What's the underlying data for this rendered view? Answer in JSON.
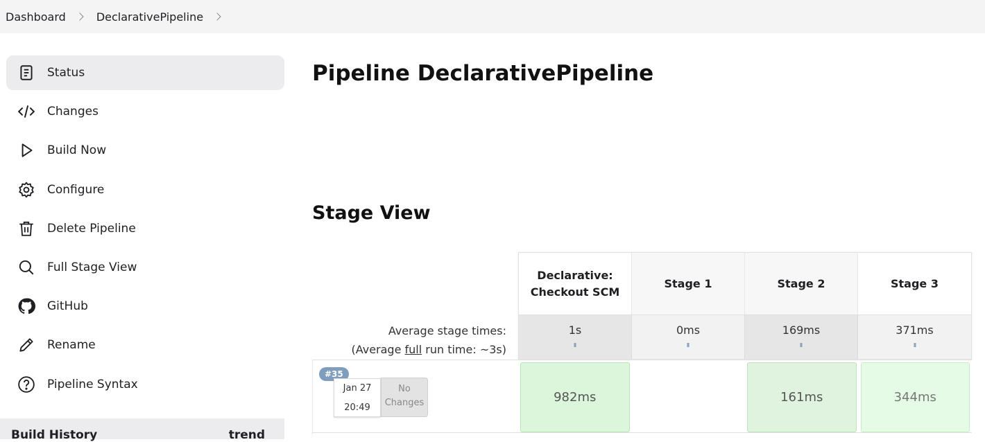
{
  "breadcrumb": [
    "Dashboard",
    "DeclarativePipeline"
  ],
  "sidebar": {
    "items": [
      {
        "label": "Status",
        "icon": "status-icon"
      },
      {
        "label": "Changes",
        "icon": "code-icon"
      },
      {
        "label": "Build Now",
        "icon": "play-icon"
      },
      {
        "label": "Configure",
        "icon": "gear-icon"
      },
      {
        "label": "Delete Pipeline",
        "icon": "trash-icon"
      },
      {
        "label": "Full Stage View",
        "icon": "search-icon"
      },
      {
        "label": "GitHub",
        "icon": "github-icon"
      },
      {
        "label": "Rename",
        "icon": "pencil-icon"
      },
      {
        "label": "Pipeline Syntax",
        "icon": "help-icon"
      }
    ],
    "build_history": {
      "label": "Build History",
      "trend": "trend"
    }
  },
  "main": {
    "title": "Pipeline DeclarativePipeline",
    "stage_view_title": "Stage View"
  },
  "stage_view": {
    "stages": [
      "Declarative: Checkout SCM",
      "Stage 1",
      "Stage 2",
      "Stage 3"
    ],
    "avg_label_line1": "Average stage times:",
    "avg_label_prefix": "(Average ",
    "avg_label_link": "full",
    "avg_label_suffix": " run time: ~3s)",
    "avg_times": [
      "1s",
      "0ms",
      "169ms",
      "371ms"
    ],
    "runs": [
      {
        "number": "#35",
        "date": "Jan 27",
        "time": "20:49",
        "changes_line1": "No",
        "changes_line2": "Changes",
        "durations": [
          "982ms",
          "",
          "161ms",
          "344ms"
        ]
      }
    ]
  }
}
